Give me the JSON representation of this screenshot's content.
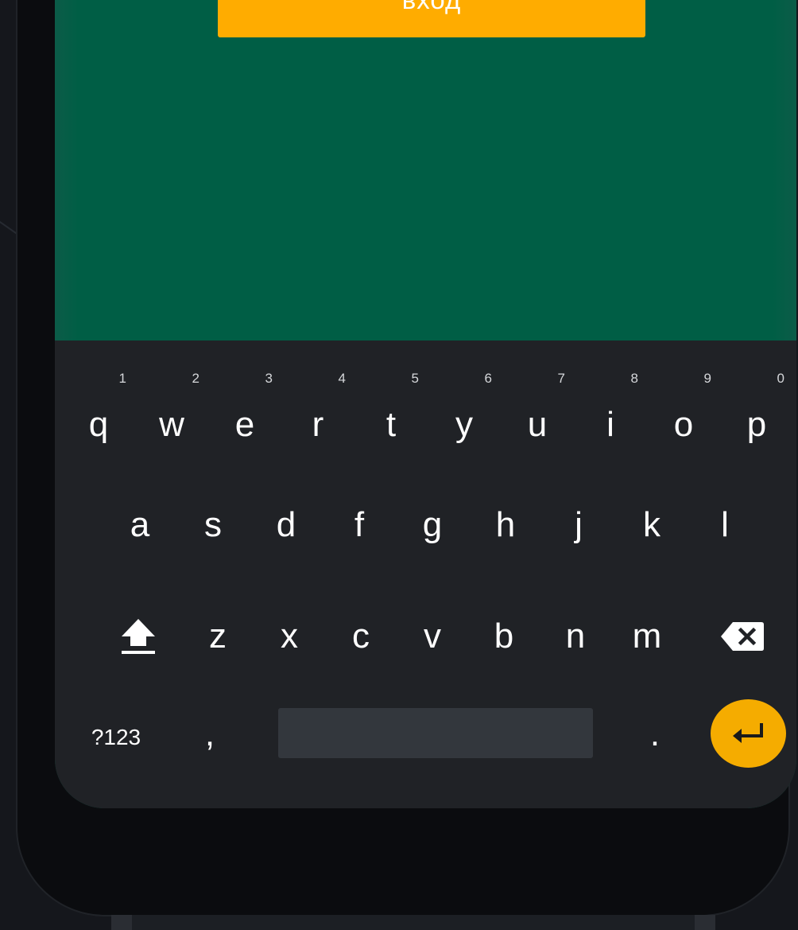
{
  "app": {
    "login_button_label": "вход"
  },
  "keyboard": {
    "row1": [
      {
        "letter": "q",
        "hint": "1"
      },
      {
        "letter": "w",
        "hint": "2"
      },
      {
        "letter": "e",
        "hint": "3"
      },
      {
        "letter": "r",
        "hint": "4"
      },
      {
        "letter": "t",
        "hint": "5"
      },
      {
        "letter": "y",
        "hint": "6"
      },
      {
        "letter": "u",
        "hint": "7"
      },
      {
        "letter": "i",
        "hint": "8"
      },
      {
        "letter": "o",
        "hint": "9"
      },
      {
        "letter": "p",
        "hint": "0"
      }
    ],
    "row2": [
      "a",
      "s",
      "d",
      "f",
      "g",
      "h",
      "j",
      "k",
      "l"
    ],
    "row3": [
      "z",
      "x",
      "c",
      "v",
      "b",
      "n",
      "m"
    ],
    "row4": {
      "symbols_label": "?123",
      "comma_label": ",",
      "period_label": "."
    },
    "icons": {
      "shift": "shift-icon",
      "backspace": "backspace-icon",
      "enter": "enter-icon"
    }
  },
  "colors": {
    "app_background": "#005e45",
    "login_button": "#ffac00",
    "keyboard_background": "#202226",
    "spacebar": "#33373d",
    "enter_key": "#f5ac00"
  }
}
